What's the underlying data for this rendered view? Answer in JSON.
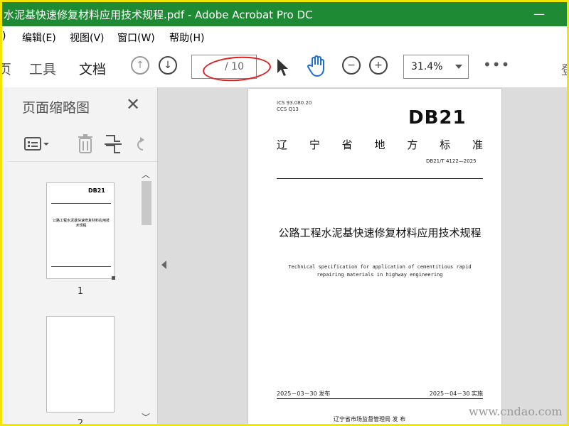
{
  "window": {
    "title": "水泥基快速修复材料应用技术规程.pdf - Adobe Acrobat Pro DC",
    "minimize": "—",
    "maximize": "☐"
  },
  "menu": {
    "partial": ")",
    "items": [
      "编辑(E)",
      "视图(V)",
      "窗口(W)",
      "帮助(H)"
    ]
  },
  "tabs": {
    "partial": "页",
    "tools": "工具",
    "document": "文档"
  },
  "nav": {
    "current_page": "",
    "total_pages": "/ 10",
    "zoom": "31.4%",
    "more": "•••",
    "partial_right": "登"
  },
  "panel": {
    "title": "页面缩略图",
    "close": "✕",
    "thumbnails": [
      {
        "number": "1"
      },
      {
        "number": "2"
      }
    ]
  },
  "document_page": {
    "ics": "ICS  93.080.20",
    "ccs": "CCS  Q13",
    "db_mark": "DB21",
    "province_chars": [
      "辽",
      "宁",
      "省",
      "地",
      "方",
      "标",
      "准"
    ],
    "std_code": "DB21/T 4122—2025",
    "title": "公路工程水泥基快速修复材料应用技术规程",
    "english_title": "Technical specification for application of cementitious rapid repairing materials in highway engineering",
    "release_date": "2025－03－30 发布",
    "impl_date": "2025－04－30 实施",
    "publisher": "辽宁省市场监督管理局    发 布"
  },
  "watermark": "www.cndao.com",
  "colors": {
    "titlebar": "#1e8a34",
    "border": "#f2e600",
    "annotation_red": "#e02020"
  }
}
